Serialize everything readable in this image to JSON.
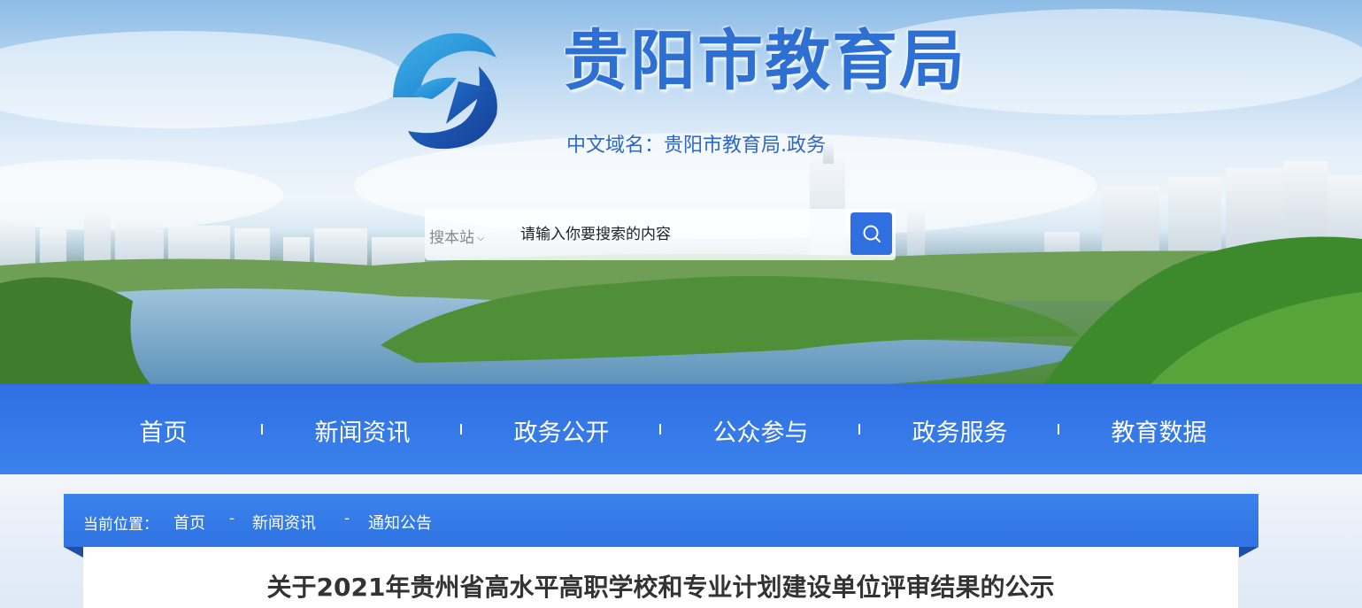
{
  "header": {
    "site_title": "贵阳市教育局",
    "domain_line": "中文域名：贵阳市教育局.政务",
    "logo_icon": "e-logo-icon"
  },
  "search": {
    "scope_label": "搜本站",
    "placeholder": "请输入你要搜索的内容",
    "button_icon": "search-icon"
  },
  "nav": {
    "items": [
      {
        "label": "首页"
      },
      {
        "label": "新闻资讯"
      },
      {
        "label": "政务公开"
      },
      {
        "label": "公众参与"
      },
      {
        "label": "政务服务"
      },
      {
        "label": "教育数据"
      }
    ]
  },
  "breadcrumb": {
    "label": "当前位置：",
    "items": [
      "首页",
      "新闻资讯",
      "通知公告"
    ],
    "separator": "-"
  },
  "article": {
    "title": "关于2021年贵州省高水平高职学校和专业计划建设单位评审结果的公示"
  },
  "colors": {
    "brand_blue": "#2f6fe3",
    "title_blue": "#2e6fd4"
  }
}
